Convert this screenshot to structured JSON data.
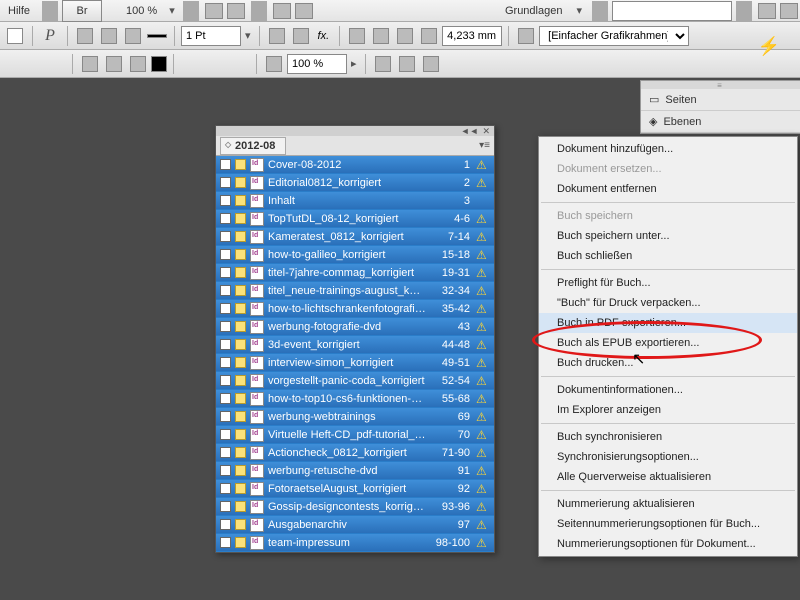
{
  "menubar": {
    "help": "Hilfe",
    "bridge": "Br",
    "zoom": "100 %",
    "workspace": "Grundlagen"
  },
  "toolbar": {
    "stroke": "1 Pt",
    "fx": "fx.",
    "opacity": "100 %",
    "size": "4,233 mm",
    "frame": "[Einfacher Grafikrahmen]"
  },
  "right_panels": {
    "seiten": "Seiten",
    "ebenen": "Ebenen"
  },
  "book": {
    "title": "2012-08",
    "rows": [
      {
        "name": "Cover-08-2012",
        "pages": "1",
        "warn": true
      },
      {
        "name": "Editorial0812_korrigiert",
        "pages": "2",
        "warn": true
      },
      {
        "name": "Inhalt",
        "pages": "3",
        "warn": false
      },
      {
        "name": "TopTutDL_08-12_korrigiert",
        "pages": "4-6",
        "warn": true
      },
      {
        "name": "Kameratest_0812_korrigiert",
        "pages": "7-14",
        "warn": true
      },
      {
        "name": "how-to-galileo_korrigiert",
        "pages": "15-18",
        "warn": true
      },
      {
        "name": "titel-7jahre-commag_korrigiert",
        "pages": "19-31",
        "warn": true
      },
      {
        "name": "titel_neue-trainings-august_kor…",
        "pages": "32-34",
        "warn": true
      },
      {
        "name": "how-to-lichtschrankenfotografie…",
        "pages": "35-42",
        "warn": true
      },
      {
        "name": "werbung-fotografie-dvd",
        "pages": "43",
        "warn": true
      },
      {
        "name": "3d-event_korrigiert",
        "pages": "44-48",
        "warn": true
      },
      {
        "name": "interview-simon_korrigiert",
        "pages": "49-51",
        "warn": true
      },
      {
        "name": "vorgestellt-panic-coda_korrigiert",
        "pages": "52-54",
        "warn": true
      },
      {
        "name": "how-to-top10-cs6-funktionen-dr…",
        "pages": "55-68",
        "warn": true
      },
      {
        "name": "werbung-webtrainings",
        "pages": "69",
        "warn": true
      },
      {
        "name": "Virtuelle Heft-CD_pdf-tutorial_korr…",
        "pages": "70",
        "warn": true
      },
      {
        "name": "Actioncheck_0812_korrigiert",
        "pages": "71-90",
        "warn": true
      },
      {
        "name": "werbung-retusche-dvd",
        "pages": "91",
        "warn": true
      },
      {
        "name": "FotoraetselAugust_korrigiert",
        "pages": "92",
        "warn": true
      },
      {
        "name": "Gossip-designcontests_korrigiert",
        "pages": "93-96",
        "warn": true
      },
      {
        "name": "Ausgabenarchiv",
        "pages": "97",
        "warn": true
      },
      {
        "name": "team-impressum",
        "pages": "98-100",
        "warn": true
      }
    ]
  },
  "context_menu": {
    "items": [
      {
        "label": "Dokument hinzufügen...",
        "enabled": true
      },
      {
        "label": "Dokument ersetzen...",
        "enabled": false
      },
      {
        "label": "Dokument entfernen",
        "enabled": true
      },
      {
        "sep": true
      },
      {
        "label": "Buch speichern",
        "enabled": false
      },
      {
        "label": "Buch speichern unter...",
        "enabled": true
      },
      {
        "label": "Buch schließen",
        "enabled": true
      },
      {
        "sep": true
      },
      {
        "label": "Preflight für Buch...",
        "enabled": true
      },
      {
        "label": "\"Buch\" für Druck verpacken...",
        "enabled": true
      },
      {
        "label": "Buch in PDF exportieren...",
        "enabled": true,
        "hover": true
      },
      {
        "label": "Buch als EPUB exportieren...",
        "enabled": true
      },
      {
        "label": "Buch drucken...",
        "enabled": true
      },
      {
        "sep": true
      },
      {
        "label": "Dokumentinformationen...",
        "enabled": true
      },
      {
        "label": "Im Explorer anzeigen",
        "enabled": true
      },
      {
        "sep": true
      },
      {
        "label": "Buch synchronisieren",
        "enabled": true
      },
      {
        "label": "Synchronisierungsoptionen...",
        "enabled": true
      },
      {
        "label": "Alle Querverweise aktualisieren",
        "enabled": true
      },
      {
        "sep": true
      },
      {
        "label": "Nummerierung aktualisieren",
        "enabled": true
      },
      {
        "label": "Seitennummerierungsoptionen für Buch...",
        "enabled": true
      },
      {
        "label": "Nummerierungsoptionen für Dokument...",
        "enabled": true
      }
    ]
  }
}
